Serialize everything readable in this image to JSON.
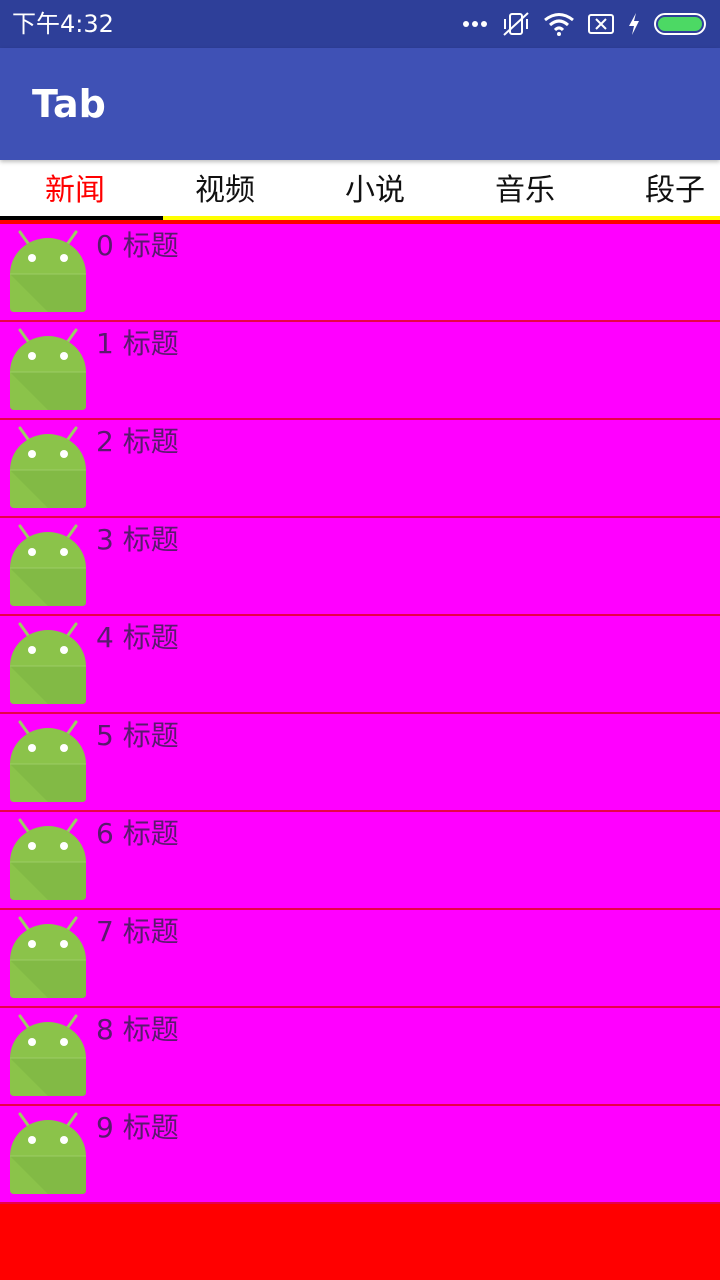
{
  "status_bar": {
    "time": "下午4:32",
    "icons": [
      "more-dots-icon",
      "vibrate-off-icon",
      "wifi-icon",
      "no-sim-icon",
      "charging-bolt-icon",
      "battery-icon"
    ],
    "background": "#2e3f99"
  },
  "app_bar": {
    "title": "Tab",
    "background": "#3f51b5"
  },
  "tabs": {
    "items": [
      {
        "label": "新闻",
        "selected": true
      },
      {
        "label": "视频",
        "selected": false
      },
      {
        "label": "小说",
        "selected": false
      },
      {
        "label": "音乐",
        "selected": false
      },
      {
        "label": "段子",
        "selected": false
      }
    ],
    "selected_color": "#ff0000",
    "indicator_color": "#000000",
    "track_color": "#ffff00"
  },
  "list": {
    "item_background": "#ff00ff",
    "page_background": "#ff0000",
    "items": [
      {
        "title": "0 标题",
        "icon": "android-icon"
      },
      {
        "title": "1 标题",
        "icon": "android-icon"
      },
      {
        "title": "2 标题",
        "icon": "android-icon"
      },
      {
        "title": "3 标题",
        "icon": "android-icon"
      },
      {
        "title": "4 标题",
        "icon": "android-icon"
      },
      {
        "title": "5 标题",
        "icon": "android-icon"
      },
      {
        "title": "6 标题",
        "icon": "android-icon"
      },
      {
        "title": "7 标题",
        "icon": "android-icon"
      },
      {
        "title": "8 标题",
        "icon": "android-icon"
      },
      {
        "title": "9 标题",
        "icon": "android-icon"
      }
    ]
  }
}
